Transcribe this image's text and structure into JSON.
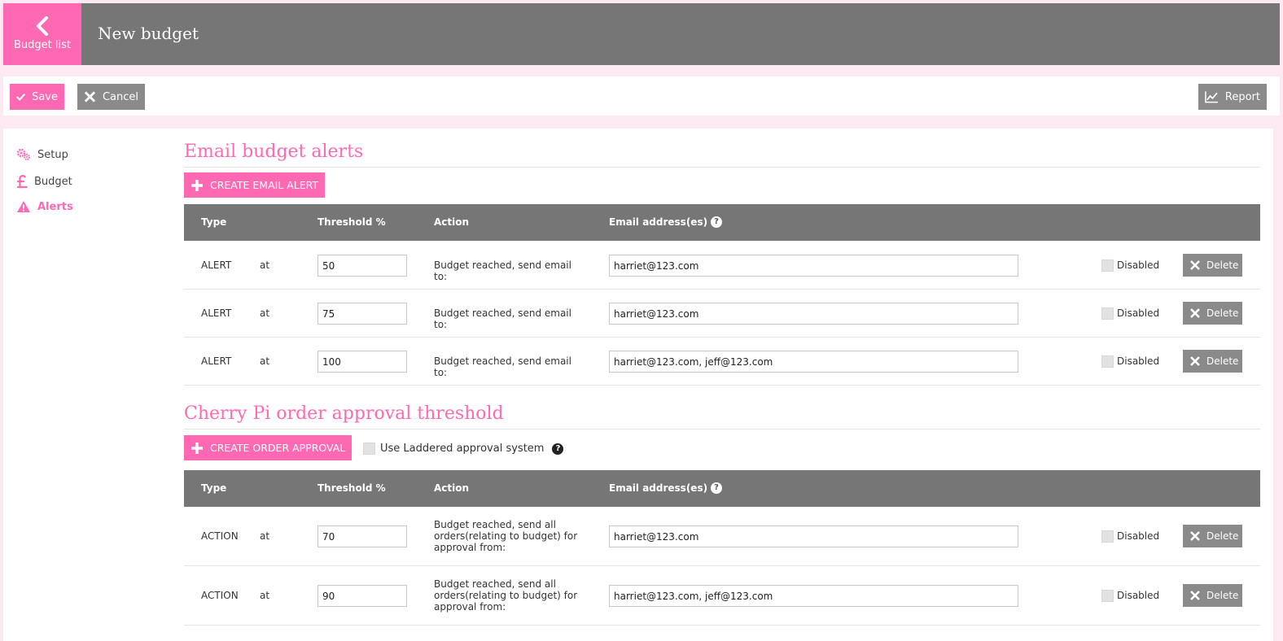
{
  "header": {
    "back_label": "Budget list",
    "title": "New budget"
  },
  "toolbar": {
    "save_label": "Save",
    "cancel_label": "Cancel",
    "report_label": "Report"
  },
  "sidebar": {
    "items": [
      {
        "label": "Setup",
        "icon": "gears-icon"
      },
      {
        "label": "Budget",
        "icon": "pound-icon"
      },
      {
        "label": "Alerts",
        "icon": "warning-icon",
        "active": true
      }
    ]
  },
  "columns": {
    "type": "Type",
    "threshold": "Threshold %",
    "action": "Action",
    "email": "Email address(es)",
    "help": "?"
  },
  "email_alerts": {
    "title": "Email budget alerts",
    "create_label": "CREATE EMAIL ALERT",
    "rows": [
      {
        "type": "ALERT",
        "at": "at",
        "threshold": "50",
        "action": "Budget reached, send email to:",
        "emails": "harriet@123.com",
        "disabled_label": "Disabled",
        "delete_label": "Delete"
      },
      {
        "type": "ALERT",
        "at": "at",
        "threshold": "75",
        "action": "Budget reached, send email to:",
        "emails": "harriet@123.com",
        "disabled_label": "Disabled",
        "delete_label": "Delete"
      },
      {
        "type": "ALERT",
        "at": "at",
        "threshold": "100",
        "action": "Budget reached, send email to:",
        "emails": "harriet@123.com, jeff@123.com",
        "disabled_label": "Disabled",
        "delete_label": "Delete"
      }
    ]
  },
  "order_approval": {
    "title": "Cherry Pi order approval threshold",
    "create_label": "CREATE ORDER APPROVAL",
    "laddered_label": "Use Laddered approval system",
    "rows": [
      {
        "type": "ACTION",
        "at": "at",
        "threshold": "70",
        "action": "Budget reached, send all orders(relating to budget) for approval from:",
        "emails": "harriet@123.com",
        "disabled_label": "Disabled",
        "delete_label": "Delete"
      },
      {
        "type": "ACTION",
        "at": "at",
        "threshold": "90",
        "action": "Budget reached, send all orders(relating to budget) for approval from:",
        "emails": "harriet@123.com, jeff@123.com",
        "disabled_label": "Disabled",
        "delete_label": "Delete"
      }
    ]
  },
  "colors": {
    "accent": "#ff69b4",
    "header": "#767676",
    "button_gray": "#8a8a8a",
    "page_bg": "#fde9f2"
  }
}
